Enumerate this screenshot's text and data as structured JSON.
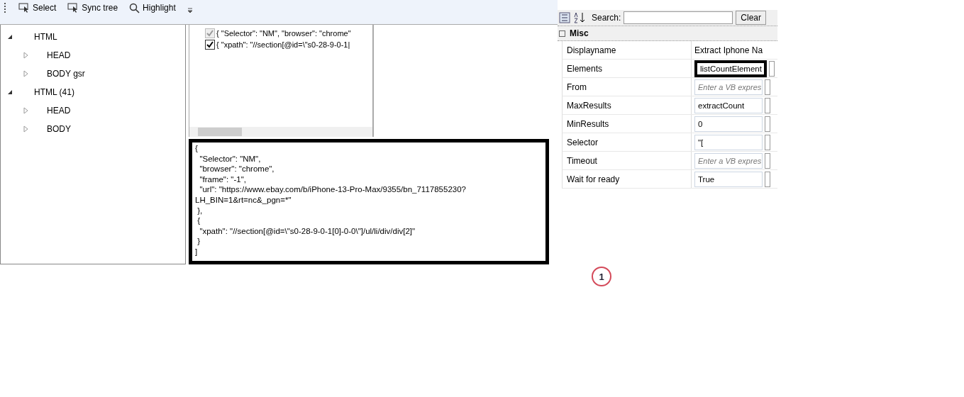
{
  "toolbar": {
    "buttons": [
      {
        "kind": "pointer",
        "label": "Select"
      },
      {
        "kind": "pointer",
        "label": "Sync tree"
      },
      {
        "kind": "search",
        "label": "Highlight"
      }
    ]
  },
  "tree": [
    {
      "label": "HTML",
      "expanded": true,
      "children": [
        {
          "label": "HEAD",
          "expanded": false
        },
        {
          "label": "BODY gsr",
          "expanded": false
        }
      ]
    },
    {
      "label": "HTML (41)",
      "expanded": true,
      "children": [
        {
          "label": "HEAD",
          "expanded": false
        },
        {
          "label": "BODY",
          "expanded": false
        }
      ]
    }
  ],
  "selectors": [
    {
      "text": "{   \"Selector\": \"NM\",   \"browser\": \"chrome\"",
      "checked": true,
      "disabled": true
    },
    {
      "text": "{   \"xpath\": \"//section[@id=\\\"s0-28-9-0-1|",
      "checked": true,
      "disabled": false
    }
  ],
  "editor": {
    "annotated": true,
    "text": "{\n  \"Selector\": \"NM\",\n  \"browser\": \"chrome\",\n  \"frame\": \"-1\",\n  \"url\": \"https://www.ebay.com/b/iPhone-13-Pro-Max/9355/bn_7117855230?\nLH_BIN=1&rt=nc&_pgn=*\"\n },\n {\n  \"xpath\": \"//section[@id=\\\"s0-28-9-0-1[0]-0-0\\\"]/ul/li/div/div[2]\"\n }\n]"
  },
  "properties": {
    "search_label": "Search:",
    "clear_button": "Clear",
    "category": "Misc",
    "rows": [
      {
        "name": "Displayname",
        "kind": "plain",
        "value": "Extract Iphone Na",
        "annotated": false
      },
      {
        "name": "Elements",
        "kind": "value",
        "value": "listCountElement",
        "annotated": true
      },
      {
        "name": "From",
        "kind": "placeholder",
        "placeholder": "Enter a VB expres",
        "annotated": false
      },
      {
        "name": "MaxResults",
        "kind": "value",
        "value": "extractCount",
        "annotated": false
      },
      {
        "name": "MinResults",
        "kind": "value",
        "value": "0",
        "annotated": false
      },
      {
        "name": "Selector",
        "kind": "value",
        "value": "\"[",
        "annotated": false
      },
      {
        "name": "Timeout",
        "kind": "placeholder",
        "placeholder": "Enter a VB expres",
        "annotated": false
      },
      {
        "name": "Wait for ready",
        "kind": "value",
        "value": "True",
        "annotated": false
      }
    ]
  },
  "badge": "1"
}
